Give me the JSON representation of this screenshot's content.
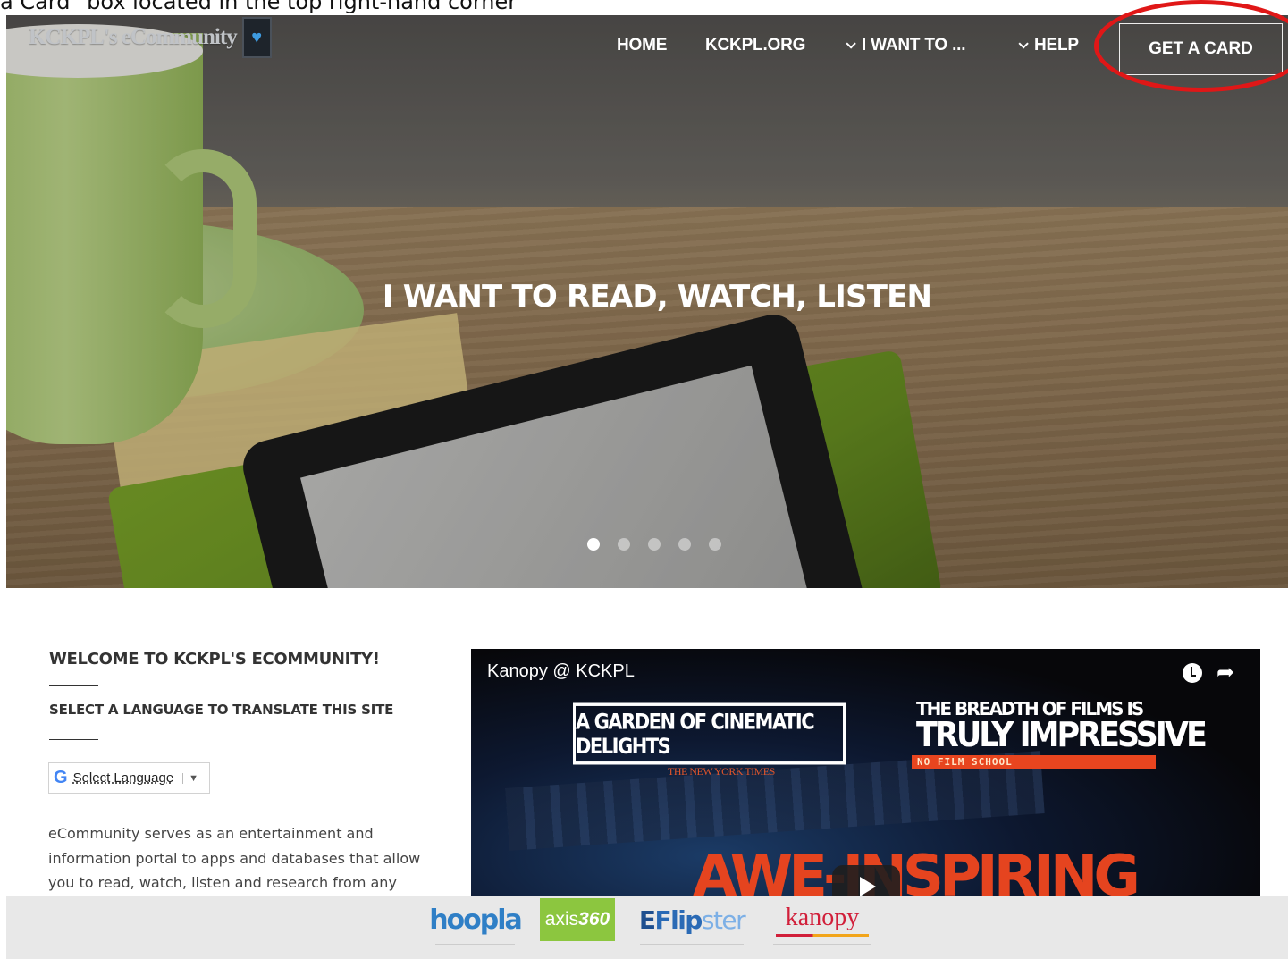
{
  "caption": "a Card\" box located in the top right-hand corner",
  "logo": {
    "text": "KCKPL's eCommunity",
    "heart": "♥"
  },
  "nav": {
    "home": "HOME",
    "kckpl": "KCKPL.ORG",
    "want": "I WANT TO ...",
    "help": "HELP",
    "card": "GET A CARD"
  },
  "hero": {
    "title": "I WANT TO READ, WATCH, LISTEN",
    "slides": 5,
    "active_slide": 1
  },
  "welcome": {
    "title": "WELCOME TO KCKPL'S ECOMMUNITY!",
    "subtitle": "SELECT A LANGUAGE TO TRANSLATE THIS SITE",
    "language_select": "Select Language",
    "language_g": "G",
    "language_arrow": "▼",
    "description": "eCommunity serves as an entertainment and information portal to apps and databases that allow you to read, watch, listen and research from any"
  },
  "video": {
    "title": "Kanopy @ KCKPL",
    "garden": "A GARDEN OF CINEMATIC DELIGHTS",
    "nyt": "THE NEW YORK TIMES",
    "breadth": "THE BREADTH OF FILMS IS",
    "truly": "TRULY IMPRESSIVE",
    "nofilm": "NO FILM SCHOOL",
    "awe": "AWE-INSPIRING",
    "share": "➦"
  },
  "footer": {
    "hoopla": "hoopla",
    "axis_a": "axis",
    "axis_b": "360",
    "flipster_b": "E",
    "flipster": "Flip",
    "flipster_s": "ster",
    "kanopy": "kanopy"
  },
  "colors": {
    "highlight": "#e01717",
    "accent": "#3e9be0"
  }
}
